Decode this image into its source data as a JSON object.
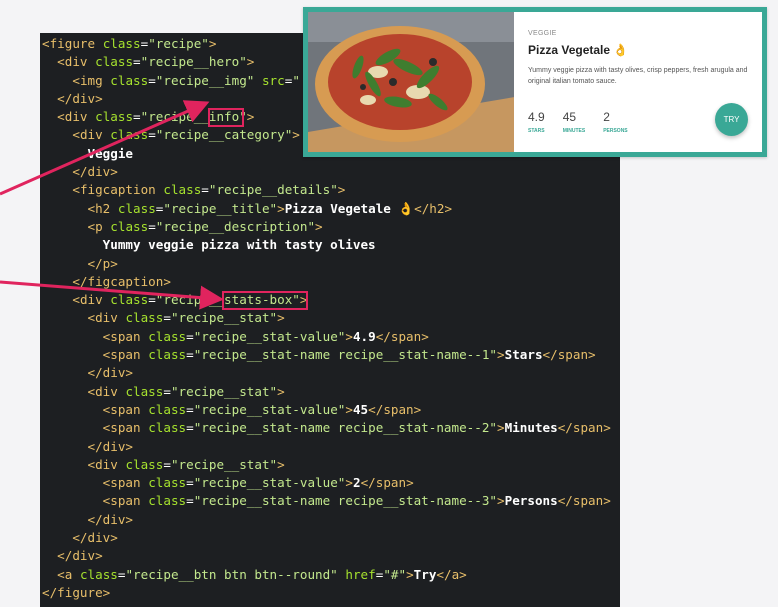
{
  "code": {
    "lines": [
      [
        [
          "ang",
          "<"
        ],
        [
          "tag",
          "figure"
        ],
        [
          "plain",
          " "
        ],
        [
          "attr",
          "class"
        ],
        [
          "plain",
          "="
        ],
        [
          "str",
          "\"recipe\""
        ],
        [
          "ang",
          ">"
        ]
      ],
      [
        [
          "plain",
          "  "
        ],
        [
          "ang",
          "<"
        ],
        [
          "tag",
          "div"
        ],
        [
          "plain",
          " "
        ],
        [
          "attr",
          "class"
        ],
        [
          "plain",
          "="
        ],
        [
          "str",
          "\"recipe__hero\""
        ],
        [
          "ang",
          ">"
        ]
      ],
      [
        [
          "plain",
          "    "
        ],
        [
          "ang",
          "<"
        ],
        [
          "tag",
          "img"
        ],
        [
          "plain",
          " "
        ],
        [
          "attr",
          "class"
        ],
        [
          "plain",
          "="
        ],
        [
          "str",
          "\"recipe__img\""
        ],
        [
          "plain",
          " "
        ],
        [
          "attr",
          "src"
        ],
        [
          "plain",
          "="
        ],
        [
          "str",
          "\""
        ]
      ],
      [
        [
          "plain",
          "  "
        ],
        [
          "ang",
          "</"
        ],
        [
          "tag",
          "div"
        ],
        [
          "ang",
          ">"
        ]
      ],
      [
        [
          "plain",
          "  "
        ],
        [
          "ang",
          "<"
        ],
        [
          "tag",
          "div"
        ],
        [
          "plain",
          " "
        ],
        [
          "attr",
          "class"
        ],
        [
          "plain",
          "="
        ],
        [
          "str",
          "\"recipe__info\""
        ],
        [
          "ang",
          ">"
        ]
      ],
      [
        [
          "plain",
          "    "
        ],
        [
          "ang",
          "<"
        ],
        [
          "tag",
          "div"
        ],
        [
          "plain",
          " "
        ],
        [
          "attr",
          "class"
        ],
        [
          "plain",
          "="
        ],
        [
          "str",
          "\"recipe__category\""
        ],
        [
          "ang",
          ">"
        ]
      ],
      [
        [
          "txt",
          "      Veggie"
        ]
      ],
      [
        [
          "plain",
          "    "
        ],
        [
          "ang",
          "</"
        ],
        [
          "tag",
          "div"
        ],
        [
          "ang",
          ">"
        ]
      ],
      [
        [
          "plain",
          "    "
        ],
        [
          "ang",
          "<"
        ],
        [
          "tag",
          "figcaption"
        ],
        [
          "plain",
          " "
        ],
        [
          "attr",
          "class"
        ],
        [
          "plain",
          "="
        ],
        [
          "str",
          "\"recipe__details\""
        ],
        [
          "ang",
          ">"
        ]
      ],
      [
        [
          "plain",
          "      "
        ],
        [
          "ang",
          "<"
        ],
        [
          "tag",
          "h2"
        ],
        [
          "plain",
          " "
        ],
        [
          "attr",
          "class"
        ],
        [
          "plain",
          "="
        ],
        [
          "str",
          "\"recipe__title\""
        ],
        [
          "ang",
          ">"
        ],
        [
          "txt",
          "Pizza Vegetale 👌"
        ],
        [
          "ang",
          "</"
        ],
        [
          "tag",
          "h2"
        ],
        [
          "ang",
          ">"
        ]
      ],
      [
        [
          "plain",
          "      "
        ],
        [
          "ang",
          "<"
        ],
        [
          "tag",
          "p"
        ],
        [
          "plain",
          " "
        ],
        [
          "attr",
          "class"
        ],
        [
          "plain",
          "="
        ],
        [
          "str",
          "\"recipe__description\""
        ],
        [
          "ang",
          ">"
        ]
      ],
      [
        [
          "txt",
          "        Yummy veggie pizza with tasty olives"
        ]
      ],
      [
        [
          "plain",
          "      "
        ],
        [
          "ang",
          "</"
        ],
        [
          "tag",
          "p"
        ],
        [
          "ang",
          ">"
        ]
      ],
      [
        [
          "plain",
          "    "
        ],
        [
          "ang",
          "</"
        ],
        [
          "tag",
          "figcaption"
        ],
        [
          "ang",
          ">"
        ]
      ],
      [
        [
          "plain",
          "    "
        ],
        [
          "ang",
          "<"
        ],
        [
          "tag",
          "div"
        ],
        [
          "plain",
          " "
        ],
        [
          "attr",
          "class"
        ],
        [
          "plain",
          "="
        ],
        [
          "str",
          "\"recipe__stats-box\""
        ],
        [
          "ang",
          ">"
        ]
      ],
      [
        [
          "plain",
          "      "
        ],
        [
          "ang",
          "<"
        ],
        [
          "tag",
          "div"
        ],
        [
          "plain",
          " "
        ],
        [
          "attr",
          "class"
        ],
        [
          "plain",
          "="
        ],
        [
          "str",
          "\"recipe__stat\""
        ],
        [
          "ang",
          ">"
        ]
      ],
      [
        [
          "plain",
          "        "
        ],
        [
          "ang",
          "<"
        ],
        [
          "tag",
          "span"
        ],
        [
          "plain",
          " "
        ],
        [
          "attr",
          "class"
        ],
        [
          "plain",
          "="
        ],
        [
          "str",
          "\"recipe__stat-value\""
        ],
        [
          "ang",
          ">"
        ],
        [
          "txt",
          "4.9"
        ],
        [
          "ang",
          "</"
        ],
        [
          "tag",
          "span"
        ],
        [
          "ang",
          ">"
        ]
      ],
      [
        [
          "plain",
          "        "
        ],
        [
          "ang",
          "<"
        ],
        [
          "tag",
          "span"
        ],
        [
          "plain",
          " "
        ],
        [
          "attr",
          "class"
        ],
        [
          "plain",
          "="
        ],
        [
          "str",
          "\"recipe__stat-name recipe__stat-name--1\""
        ],
        [
          "ang",
          ">"
        ],
        [
          "txt",
          "Stars"
        ],
        [
          "ang",
          "</"
        ],
        [
          "tag",
          "span"
        ],
        [
          "ang",
          ">"
        ]
      ],
      [
        [
          "plain",
          "      "
        ],
        [
          "ang",
          "</"
        ],
        [
          "tag",
          "div"
        ],
        [
          "ang",
          ">"
        ]
      ],
      [
        [
          "plain",
          "      "
        ],
        [
          "ang",
          "<"
        ],
        [
          "tag",
          "div"
        ],
        [
          "plain",
          " "
        ],
        [
          "attr",
          "class"
        ],
        [
          "plain",
          "="
        ],
        [
          "str",
          "\"recipe__stat\""
        ],
        [
          "ang",
          ">"
        ]
      ],
      [
        [
          "plain",
          "        "
        ],
        [
          "ang",
          "<"
        ],
        [
          "tag",
          "span"
        ],
        [
          "plain",
          " "
        ],
        [
          "attr",
          "class"
        ],
        [
          "plain",
          "="
        ],
        [
          "str",
          "\"recipe__stat-value\""
        ],
        [
          "ang",
          ">"
        ],
        [
          "txt",
          "45"
        ],
        [
          "ang",
          "</"
        ],
        [
          "tag",
          "span"
        ],
        [
          "ang",
          ">"
        ]
      ],
      [
        [
          "plain",
          "        "
        ],
        [
          "ang",
          "<"
        ],
        [
          "tag",
          "span"
        ],
        [
          "plain",
          " "
        ],
        [
          "attr",
          "class"
        ],
        [
          "plain",
          "="
        ],
        [
          "str",
          "\"recipe__stat-name recipe__stat-name--2\""
        ],
        [
          "ang",
          ">"
        ],
        [
          "txt",
          "Minutes"
        ],
        [
          "ang",
          "</"
        ],
        [
          "tag",
          "span"
        ],
        [
          "ang",
          ">"
        ]
      ],
      [
        [
          "plain",
          "      "
        ],
        [
          "ang",
          "</"
        ],
        [
          "tag",
          "div"
        ],
        [
          "ang",
          ">"
        ]
      ],
      [
        [
          "plain",
          "      "
        ],
        [
          "ang",
          "<"
        ],
        [
          "tag",
          "div"
        ],
        [
          "plain",
          " "
        ],
        [
          "attr",
          "class"
        ],
        [
          "plain",
          "="
        ],
        [
          "str",
          "\"recipe__stat\""
        ],
        [
          "ang",
          ">"
        ]
      ],
      [
        [
          "plain",
          "        "
        ],
        [
          "ang",
          "<"
        ],
        [
          "tag",
          "span"
        ],
        [
          "plain",
          " "
        ],
        [
          "attr",
          "class"
        ],
        [
          "plain",
          "="
        ],
        [
          "str",
          "\"recipe__stat-value\""
        ],
        [
          "ang",
          ">"
        ],
        [
          "txt",
          "2"
        ],
        [
          "ang",
          "</"
        ],
        [
          "tag",
          "span"
        ],
        [
          "ang",
          ">"
        ]
      ],
      [
        [
          "plain",
          "        "
        ],
        [
          "ang",
          "<"
        ],
        [
          "tag",
          "span"
        ],
        [
          "plain",
          " "
        ],
        [
          "attr",
          "class"
        ],
        [
          "plain",
          "="
        ],
        [
          "str",
          "\"recipe__stat-name recipe__stat-name--3\""
        ],
        [
          "ang",
          ">"
        ],
        [
          "txt",
          "Persons"
        ],
        [
          "ang",
          "</"
        ],
        [
          "tag",
          "span"
        ],
        [
          "ang",
          ">"
        ]
      ],
      [
        [
          "plain",
          "      "
        ],
        [
          "ang",
          "</"
        ],
        [
          "tag",
          "div"
        ],
        [
          "ang",
          ">"
        ]
      ],
      [
        [
          "plain",
          "    "
        ],
        [
          "ang",
          "</"
        ],
        [
          "tag",
          "div"
        ],
        [
          "ang",
          ">"
        ]
      ],
      [
        [
          "plain",
          "  "
        ],
        [
          "ang",
          "</"
        ],
        [
          "tag",
          "div"
        ],
        [
          "ang",
          ">"
        ]
      ],
      [
        [
          "plain",
          "  "
        ],
        [
          "ang",
          "<"
        ],
        [
          "tag",
          "a"
        ],
        [
          "plain",
          " "
        ],
        [
          "attr",
          "class"
        ],
        [
          "plain",
          "="
        ],
        [
          "str",
          "\"recipe__btn btn btn--round\""
        ],
        [
          "plain",
          " "
        ],
        [
          "attr",
          "href"
        ],
        [
          "plain",
          "="
        ],
        [
          "str",
          "\"#\""
        ],
        [
          "ang",
          ">"
        ],
        [
          "txt",
          "Try"
        ],
        [
          "ang",
          "</"
        ],
        [
          "tag",
          "a"
        ],
        [
          "ang",
          ">"
        ]
      ],
      [
        [
          "ang",
          "</"
        ],
        [
          "tag",
          "figure"
        ],
        [
          "ang",
          ">"
        ]
      ]
    ]
  },
  "card": {
    "category": "VEGGIE",
    "title": "Pizza Vegetale 👌",
    "description": "Yummy veggie pizza with tasty olives, crisp peppers, fresh arugula and original italian tomato sauce.",
    "stats": [
      {
        "value": "4.9",
        "name": "STARS"
      },
      {
        "value": "45",
        "name": "MINUTES"
      },
      {
        "value": "2",
        "name": "PERSONS"
      }
    ],
    "button_label": "TRY"
  },
  "colors": {
    "accent": "#3aa896",
    "highlight": "#e0245e",
    "editor_bg": "#1d1f22"
  }
}
